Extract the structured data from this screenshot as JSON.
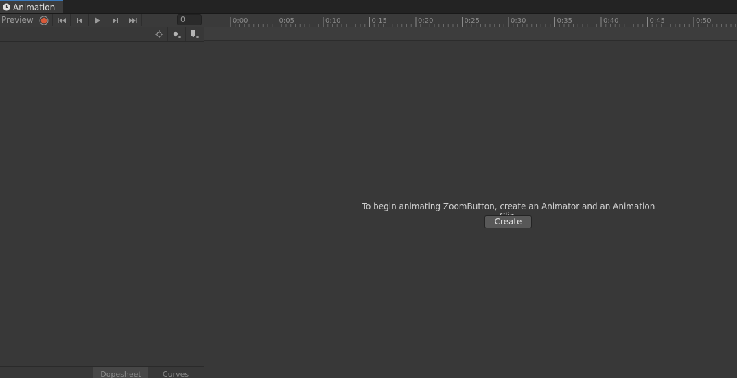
{
  "window": {
    "tab_label": "Animation",
    "tab_icon": "clock-icon"
  },
  "toolbar": {
    "preview_label": "Preview",
    "record_icon": "record-icon",
    "buttons": [
      "first-key-icon",
      "prev-key-icon",
      "play-icon",
      "next-key-icon",
      "last-key-icon"
    ],
    "frame_value": "0",
    "filter_icon": "crosshair-icon",
    "add_key_icon": "add-keyframe-icon",
    "add_event_icon": "add-event-icon"
  },
  "timeline": {
    "ticks": [
      "0:00",
      "0:05",
      "0:10",
      "0:15",
      "0:20",
      "0:25",
      "0:30",
      "0:35",
      "0:40",
      "0:45",
      "0:50"
    ]
  },
  "content": {
    "message": "To begin animating ZoomButton, create an Animator and an Animation Clip.",
    "create_label": "Create"
  },
  "bottom_tabs": {
    "dopesheet": "Dopesheet",
    "curves": "Curves"
  },
  "colors": {
    "record": "#d75a3a",
    "accent": "#3a79bb"
  }
}
